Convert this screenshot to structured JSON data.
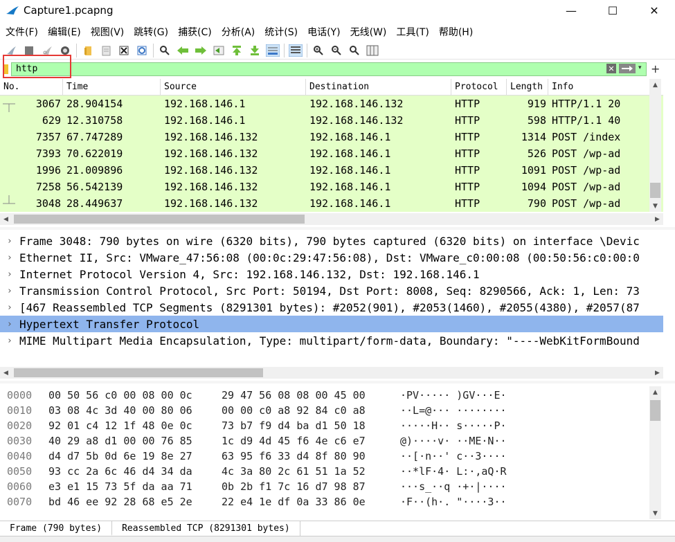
{
  "window": {
    "title": "Capture1.pcapng",
    "minimize_glyph": "—",
    "maximize_glyph": "☐",
    "close_glyph": "✕"
  },
  "menu": [
    "文件(F)",
    "编辑(E)",
    "视图(V)",
    "跳转(G)",
    "捕获(C)",
    "分析(A)",
    "统计(S)",
    "电话(Y)",
    "无线(W)",
    "工具(T)",
    "帮助(H)"
  ],
  "filter": {
    "value": "http",
    "clear_glyph": "✕",
    "dropdown_glyph": "▾",
    "add_glyph": "+"
  },
  "packet_list": {
    "columns": [
      "No.",
      "Time",
      "Source",
      "Destination",
      "Protocol",
      "Length",
      "Info"
    ],
    "rows": [
      {
        "no": "3067",
        "time": "28.904154",
        "src": "192.168.146.1",
        "dst": "192.168.146.132",
        "proto": "HTTP",
        "len": "919",
        "info": "HTTP/1.1 20",
        "marker": "first"
      },
      {
        "no": "629",
        "time": "12.310758",
        "src": "192.168.146.1",
        "dst": "192.168.146.132",
        "proto": "HTTP",
        "len": "598",
        "info": "HTTP/1.1 40",
        "marker": ""
      },
      {
        "no": "7357",
        "time": "67.747289",
        "src": "192.168.146.132",
        "dst": "192.168.146.1",
        "proto": "HTTP",
        "len": "1314",
        "info": "POST /index",
        "marker": ""
      },
      {
        "no": "7393",
        "time": "70.622019",
        "src": "192.168.146.132",
        "dst": "192.168.146.1",
        "proto": "HTTP",
        "len": "526",
        "info": "POST /wp-ad",
        "marker": ""
      },
      {
        "no": "1996",
        "time": "21.009896",
        "src": "192.168.146.132",
        "dst": "192.168.146.1",
        "proto": "HTTP",
        "len": "1091",
        "info": "POST /wp-ad",
        "marker": ""
      },
      {
        "no": "7258",
        "time": "56.542139",
        "src": "192.168.146.132",
        "dst": "192.168.146.1",
        "proto": "HTTP",
        "len": "1094",
        "info": "POST /wp-ad",
        "marker": ""
      },
      {
        "no": "3048",
        "time": "28.449637",
        "src": "192.168.146.132",
        "dst": "192.168.146.1",
        "proto": "HTTP",
        "len": "790",
        "info": "POST /wp-ad",
        "marker": "last"
      }
    ]
  },
  "details": [
    {
      "text": "Frame 3048: 790 bytes on wire (6320 bits), 790 bytes captured (6320 bits) on interface \\Devic",
      "selected": false
    },
    {
      "text": "Ethernet II, Src: VMware_47:56:08 (00:0c:29:47:56:08), Dst: VMware_c0:00:08 (00:50:56:c0:00:0",
      "selected": false
    },
    {
      "text": "Internet Protocol Version 4, Src: 192.168.146.132, Dst: 192.168.146.1",
      "selected": false
    },
    {
      "text": "Transmission Control Protocol, Src Port: 50194, Dst Port: 8008, Seq: 8290566, Ack: 1, Len: 73",
      "selected": false
    },
    {
      "text": "[467 Reassembled TCP Segments (8291301 bytes): #2052(901), #2053(1460), #2055(4380), #2057(87",
      "selected": false
    },
    {
      "text": "Hypertext Transfer Protocol",
      "selected": true
    },
    {
      "text": "MIME Multipart Media Encapsulation, Type: multipart/form-data, Boundary: \"----WebKitFormBound",
      "selected": false
    }
  ],
  "bytes": [
    {
      "off": "0000",
      "h1": "00 50 56 c0 00 08 00 0c",
      "h2": "29 47 56 08 08 00 45 00",
      "ascii": "·PV·····  )GV···E·"
    },
    {
      "off": "0010",
      "h1": "03 08 4c 3d 40 00 80 06",
      "h2": "00 00 c0 a8 92 84 c0 a8",
      "ascii": "··L=@···  ········"
    },
    {
      "off": "0020",
      "h1": "92 01 c4 12 1f 48 0e 0c",
      "h2": "73 b7 f9 d4 ba d1 50 18",
      "ascii": "·····H··  s·····P·"
    },
    {
      "off": "0030",
      "h1": "40 29 a8 d1 00 00 76 85",
      "h2": "1c d9 4d 45 f6 4e c6 e7",
      "ascii": "@)····v·  ··ME·N··"
    },
    {
      "off": "0040",
      "h1": "d4 d7 5b 0d 6e 19 8e 27",
      "h2": "63 95 f6 33 d4 8f 80 90",
      "ascii": "··[·n··'  c··3····"
    },
    {
      "off": "0050",
      "h1": "93 cc 2a 6c 46 d4 34 da",
      "h2": "4c 3a 80 2c 61 51 1a 52",
      "ascii": "··*lF·4·  L:·,aQ·R"
    },
    {
      "off": "0060",
      "h1": "e3 e1 15 73 5f da aa 71",
      "h2": "0b 2b f1 7c 16 d7 98 87",
      "ascii": "···s_··q  ·+·|····"
    },
    {
      "off": "0070",
      "h1": "bd 46 ee 92 28 68 e5 2e",
      "h2": "22 e4 1e df 0a 33 86 0e",
      "ascii": "·F··(h·.  \"····3··"
    }
  ],
  "bottom_tabs": [
    "Frame (790 bytes)",
    "Reassembled TCP (8291301 bytes)"
  ],
  "colors": {
    "filter_bg": "#afffaf",
    "row_bg": "#e4ffc7",
    "selected_bg": "#8fb5ed",
    "highlight_border": "#e53935"
  }
}
